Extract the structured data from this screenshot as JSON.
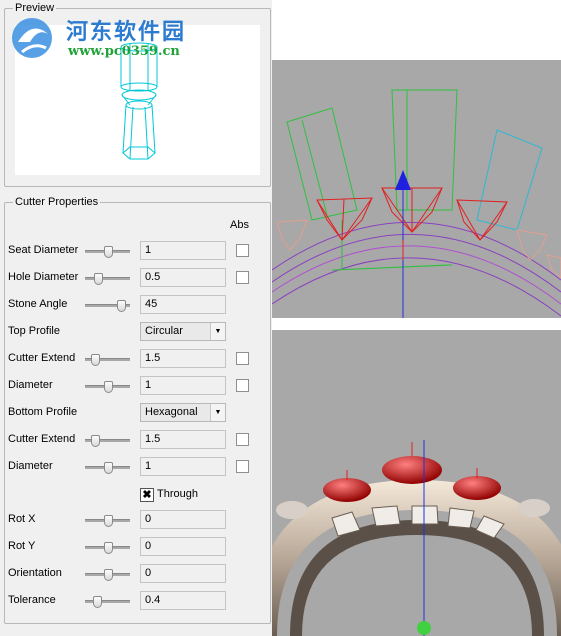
{
  "preview": {
    "title": "Preview"
  },
  "watermark": {
    "site_name": "河东软件园",
    "url": "www.pc0359.cn"
  },
  "cutter": {
    "title": "Cutter Properties",
    "abs_header": "Abs",
    "rows": [
      {
        "label": "Seat Diameter",
        "value": "1"
      },
      {
        "label": "Hole Diameter",
        "value": "0.5"
      },
      {
        "label": "Stone Angle",
        "value": "45"
      },
      {
        "label": "Top Profile",
        "value": "Circular"
      },
      {
        "label": "Cutter Extend",
        "value": "1.5"
      },
      {
        "label": "Diameter",
        "value": "1"
      },
      {
        "label": "Bottom Profile",
        "value": "Hexagonal"
      },
      {
        "label": "Cutter Extend",
        "value": "1.5"
      },
      {
        "label": "Diameter",
        "value": "1"
      },
      {
        "label": "Through",
        "checked": true
      },
      {
        "label": "Rot X",
        "value": "0"
      },
      {
        "label": "Rot Y",
        "value": "0"
      },
      {
        "label": "Orientation",
        "value": "0"
      },
      {
        "label": "Tolerance",
        "value": "0.4"
      }
    ]
  },
  "colors": {
    "panel_bg": "#f0f0f0",
    "viewport_bg": "#a8a8a8",
    "cutter_wire": "#00c8d8"
  },
  "icons": {
    "through_check": "✖",
    "combo_arrow": "▼"
  }
}
